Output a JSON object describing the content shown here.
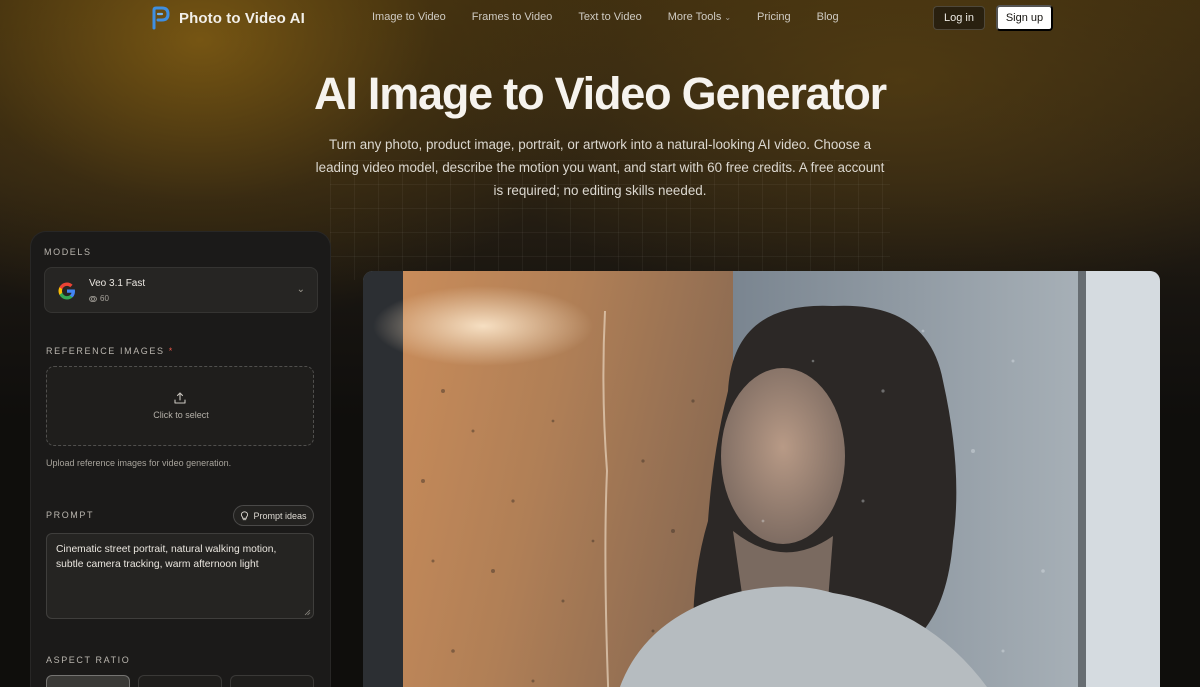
{
  "nav": {
    "brand": "Photo to Video AI",
    "links": [
      {
        "label": "Image to Video",
        "dropdown": false
      },
      {
        "label": "Frames to Video",
        "dropdown": false
      },
      {
        "label": "Text to Video",
        "dropdown": false
      },
      {
        "label": "More Tools",
        "dropdown": true
      },
      {
        "label": "Pricing",
        "dropdown": false
      },
      {
        "label": "Blog",
        "dropdown": false
      }
    ],
    "login": "Log in",
    "signup": "Sign up"
  },
  "hero": {
    "title": "AI Image to Video Generator",
    "subtitle": "Turn any photo, product image, portrait, or artwork into a natural-looking AI video. Choose a leading video model, describe the motion you want, and start with 60 free credits. A free account is required; no editing skills needed."
  },
  "panel": {
    "models_label": "MODELS",
    "model": {
      "name": "Veo 3.1 Fast",
      "credits": "60",
      "icon": "google-icon"
    },
    "reference_label": "REFERENCE IMAGES",
    "required_mark": "*",
    "upload_text": "Click to select",
    "upload_help": "Upload reference images for video generation.",
    "prompt_label": "PROMPT",
    "prompt_ideas": "Prompt ideas",
    "prompt_value": "Cinematic street portrait, natural walking motion, subtle camera tracking, warm afternoon light",
    "aspect_label": "ASPECT RATIO"
  },
  "colors": {
    "accent_glow": "#8b6414",
    "panel_bg": "#1b1a19",
    "required": "#e8584a"
  }
}
